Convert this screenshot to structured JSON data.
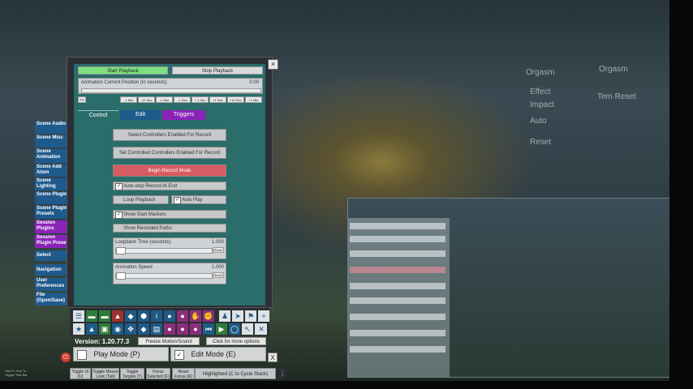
{
  "vr_menu": {
    "items": [
      "Orgasm",
      "Orgasm",
      "Effect",
      "Impact",
      "Auto",
      "Tem Reset",
      "Reset"
    ]
  },
  "playback": {
    "start_label": "Start Playback",
    "stop_label": "Stop Playback",
    "position_label": "Animation Current Position (in seconds)",
    "position_value": "0.00",
    "step_buttons": [
      "<<",
      "-1 Min",
      "-10 Sec",
      "-1 Sec",
      "-.1 Sec",
      "+.1 Sec",
      "+1 Sec",
      "+10 Sec",
      "+1 Min"
    ]
  },
  "tabs": [
    {
      "label": "Control"
    },
    {
      "label": "Edit"
    },
    {
      "label": "Triggers"
    }
  ],
  "controls": {
    "select_record": "Select Controllers Enabled For Record",
    "set_record": "Set Controlled Controllers Enabled For Record",
    "begin_record": "Begin Record Mode",
    "auto_stop": "Auto-stop Record At End",
    "loop": "Loop Playback",
    "auto_play": "Auto Play",
    "show_markers": "Show Start Markers",
    "show_paths": "Show Recorded Paths",
    "loopback_label": "Loopback Time (seconds)",
    "loopback_value": "1.000",
    "speed_label": "Animation Speed",
    "speed_value": "1.000",
    "reset": "Reset"
  },
  "sidebar": [
    {
      "label": "Scene Audio",
      "style": "blue"
    },
    {
      "label": "Scene Misc",
      "style": "blue"
    },
    {
      "label": "Scene Animation",
      "style": "blue"
    },
    {
      "label": "Scene Add Atom",
      "style": "blue"
    },
    {
      "label": "Scene Lighting",
      "style": "blue"
    },
    {
      "label": "Scene Plugins",
      "style": "blue"
    },
    {
      "label": "Scene Plugin Presets",
      "style": "blue"
    },
    {
      "label": "Session Plugins",
      "style": "purple"
    },
    {
      "label": "Session Plugin Presets",
      "style": "purple"
    },
    {
      "label": "Select",
      "style": "blue"
    },
    {
      "label": "Navigation",
      "style": "blue"
    },
    {
      "label": "User Preferences",
      "style": "blue"
    },
    {
      "label": "File (Open/Save)",
      "style": "blue"
    }
  ],
  "footer": {
    "version": "Version: 1.20.77.3",
    "freeze": "Freeze Motion/Sound",
    "more": "Click for more options",
    "play_mode": "Play Mode (P)",
    "edit_mode": "Edit Mode (E)",
    "close": "X",
    "hint_left": "Use F1 Key To Toggle This Bar",
    "bottom_buttons": [
      "Toggle UI (U)",
      "Toggle Mouse Look (Tab)",
      "Toggle Targets (T)",
      "Focus Selected (F)",
      "Reset Focus (R)"
    ],
    "highlighted": "Highlighted (C to Cycle Stack)"
  }
}
